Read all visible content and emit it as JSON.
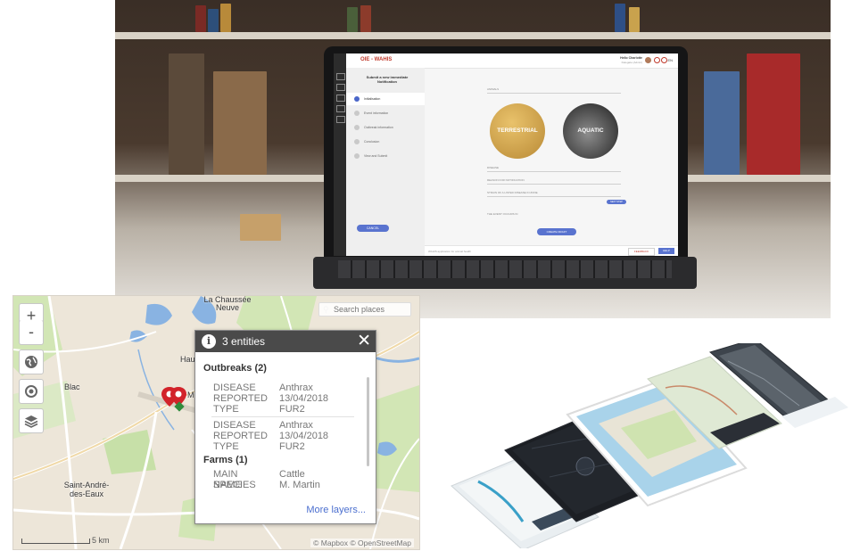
{
  "laptop": {
    "app_title": "OIE - WAHIS",
    "user_name": "Hello Charlotte",
    "user_role": "Delegate (Admin)",
    "lang": "EN",
    "side_title": "Submit a new immediate Notification",
    "steps": [
      "Initialisation",
      "Event information",
      "Outbreak information",
      "Conclusion",
      "View and Submit"
    ],
    "cancel": "CANCEL",
    "choices": {
      "terrestrial": "TERRESTRIAL",
      "aquatic": "AQUATIC"
    },
    "field_labels": [
      "ANIMALS",
      "DISEASE",
      "REASON FOR NOTIFICATION",
      "STRAIN OF A LISTED DISEASE IN ZONE",
      "THE EVENT OCCURS IN"
    ],
    "small_button": "NEXT STEP",
    "create": "CREATE DRAFT",
    "feedback": "FEEDBACK",
    "help": "HELP",
    "footer": "WAHIS application for animal health"
  },
  "map": {
    "search_placeholder": "Search places",
    "controls": {
      "zoom_in": "+",
      "zoom_out": "-"
    },
    "labels": {
      "la_chaussee": "La Chaussée Neuve",
      "hau": "Hau",
      "blac": "Blac",
      "saint_andre": "Saint-André- des-Eaux",
      "m": "M"
    },
    "scale": "5 km",
    "attribution": "© Mapbox © OpenStreetMap",
    "popup": {
      "title": "3 entities",
      "close": "✕",
      "info": "i",
      "outbreaks_title": "Outbreaks (2)",
      "outbreaks": [
        {
          "k1": "DISEASE",
          "v1": "Anthrax",
          "k2": "REPORTED",
          "v2": "13/04/2018",
          "k3": "TYPE",
          "v3": "FUR2"
        },
        {
          "k1": "DISEASE",
          "v1": "Anthrax",
          "k2": "REPORTED",
          "v2": "13/04/2018",
          "k3": "TYPE",
          "v3": "FUR2"
        }
      ],
      "farms_title": "Farms (1)",
      "farm": {
        "k1": "MAIN SPECIES",
        "v1": "Cattle",
        "k2": "NAME",
        "v2": "M. Martin"
      },
      "more": "More layers..."
    }
  },
  "colors": {
    "accent_blue": "#5973cf",
    "brand_red": "#c0392b",
    "map_water": "#7da7d9",
    "map_green": "#cfe3b0",
    "marker_red": "#d2232a",
    "marker_green": "#2e8b3c"
  }
}
